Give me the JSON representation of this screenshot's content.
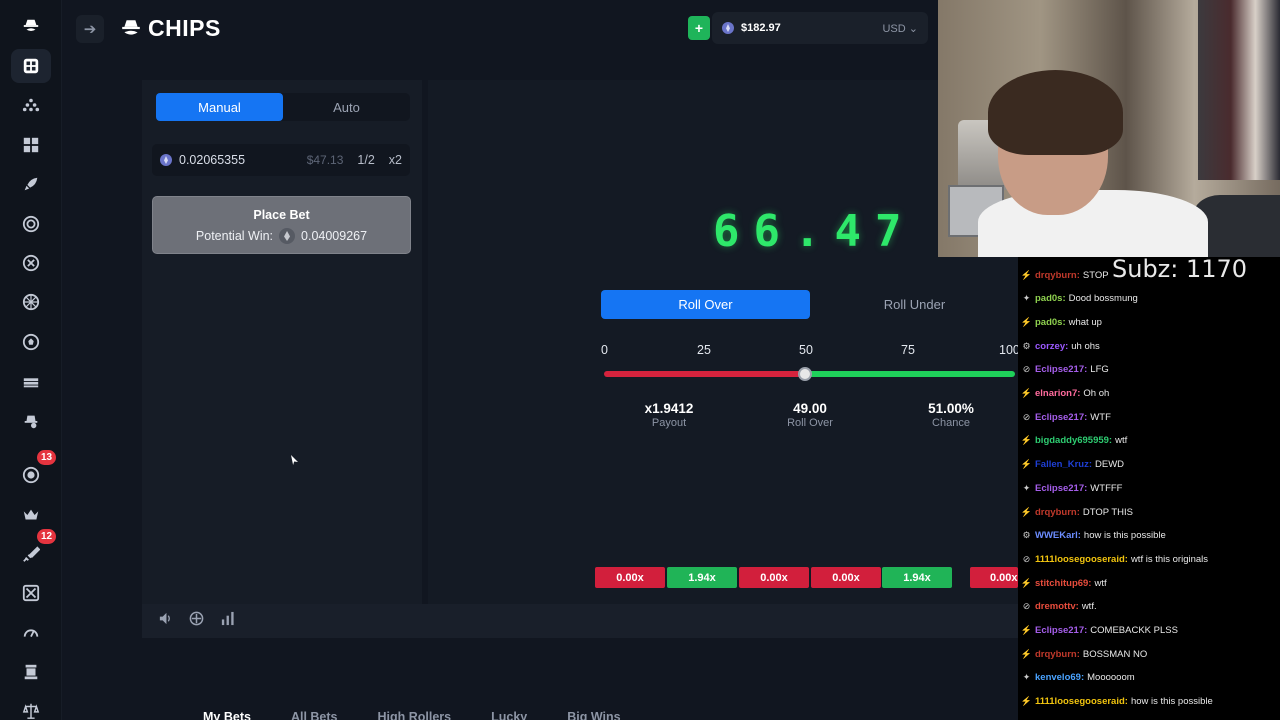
{
  "sidebar": {
    "items": [
      {
        "icon": "logo-icon"
      },
      {
        "icon": "grid-icon"
      },
      {
        "icon": "triangle-dots-icon"
      },
      {
        "icon": "numbers-icon"
      },
      {
        "icon": "rocket-icon"
      },
      {
        "icon": "target-icon"
      },
      {
        "icon": "x-circle-icon"
      },
      {
        "icon": "wheel-icon"
      },
      {
        "icon": "ball-icon"
      },
      {
        "icon": "chips-stack-icon"
      },
      {
        "icon": "hat-icon"
      },
      {
        "icon": "rewards-icon",
        "badge": "13"
      },
      {
        "icon": "crown-icon"
      },
      {
        "icon": "sword-icon",
        "badge": "12"
      },
      {
        "icon": "dice-box-icon"
      },
      {
        "icon": "gauge-icon"
      },
      {
        "icon": "hat-stack-icon"
      },
      {
        "icon": "scales-icon"
      }
    ]
  },
  "header": {
    "brand": "CHIPS",
    "deposit_label": "+",
    "balance": "$182.97",
    "currency": "USD"
  },
  "bet_panel": {
    "tabs": [
      "Manual",
      "Auto"
    ],
    "active_tab": "Manual",
    "bet_amount": "0.02065355",
    "bet_usd": "$47.13",
    "half_label": "1/2",
    "double_label": "x2",
    "place_bet_label": "Place Bet",
    "potential_win_label": "Potential Win:",
    "potential_win_value": "0.04009267"
  },
  "game": {
    "result": "66.47",
    "modes": [
      "Roll Over",
      "Roll Under"
    ],
    "active_mode": "Roll Over",
    "slider_ticks": [
      "0",
      "25",
      "50",
      "75",
      "100"
    ],
    "slider_value": 49,
    "stats": [
      {
        "value": "x1.9412",
        "label": "Payout"
      },
      {
        "value": "49.00",
        "label": "Roll Over"
      },
      {
        "value": "51.00%",
        "label": "Chance"
      }
    ],
    "history": [
      {
        "value": "0.00x",
        "result": "loss"
      },
      {
        "value": "1.94x",
        "result": "win"
      },
      {
        "value": "0.00x",
        "result": "loss"
      },
      {
        "value": "0.00x",
        "result": "loss"
      },
      {
        "value": "1.94x",
        "result": "win"
      },
      {
        "value": "0.00x",
        "result": "loss"
      }
    ]
  },
  "toolbar": {
    "icons": [
      "volume-icon",
      "gamepad-icon",
      "stats-icon"
    ]
  },
  "bets_tabs": [
    "My Bets",
    "All Bets",
    "High Rollers",
    "Lucky",
    "Big Wins"
  ],
  "stream": {
    "overlay_title": "Subz: 1170",
    "chat": [
      {
        "user": "drqyburn",
        "message": "STOP",
        "color": "#c0392b"
      },
      {
        "user": "pad0s",
        "message": "Dood bossmung",
        "color": "#8fd14f"
      },
      {
        "user": "pad0s",
        "message": "what up",
        "color": "#8fd14f"
      },
      {
        "user": "corzey",
        "message": "uh ohs",
        "color": "#9b59ff"
      },
      {
        "user": "Eclipse217",
        "message": "LFG",
        "color": "#a55eea"
      },
      {
        "user": "elnarion7",
        "message": "Oh oh",
        "color": "#ff6b9d"
      },
      {
        "user": "Eclipse217",
        "message": "WTF",
        "color": "#a55eea"
      },
      {
        "user": "bigdaddy695959",
        "message": "wtf",
        "color": "#2ecc71"
      },
      {
        "user": "Fallen_Kruz",
        "message": "DEWD",
        "color": "#1e3fd6"
      },
      {
        "user": "Eclipse217",
        "message": "WTFFF",
        "color": "#a55eea"
      },
      {
        "user": "drqyburn",
        "message": "DTOP THIS",
        "color": "#c0392b"
      },
      {
        "user": "WWEKarl",
        "message": "how is this possible",
        "color": "#6c8dff"
      },
      {
        "user": "1111loosegooseraid",
        "message": "wtf is this originals",
        "color": "#f1c40f"
      },
      {
        "user": "stitchitup69",
        "message": "wtf",
        "color": "#e74c3c"
      },
      {
        "user": "dremottv",
        "message": "wtf.",
        "color": "#e74c3c"
      },
      {
        "user": "Eclipse217",
        "message": "COMEBACKK PLSS",
        "color": "#a55eea"
      },
      {
        "user": "drqyburn",
        "message": "BOSSMAN NO",
        "color": "#c0392b"
      },
      {
        "user": "kenvelo69",
        "message": "Moooooom",
        "color": "#4aa3ff"
      },
      {
        "user": "1111loosegooseraid",
        "message": "how is this possible",
        "color": "#f1c40f"
      }
    ]
  }
}
